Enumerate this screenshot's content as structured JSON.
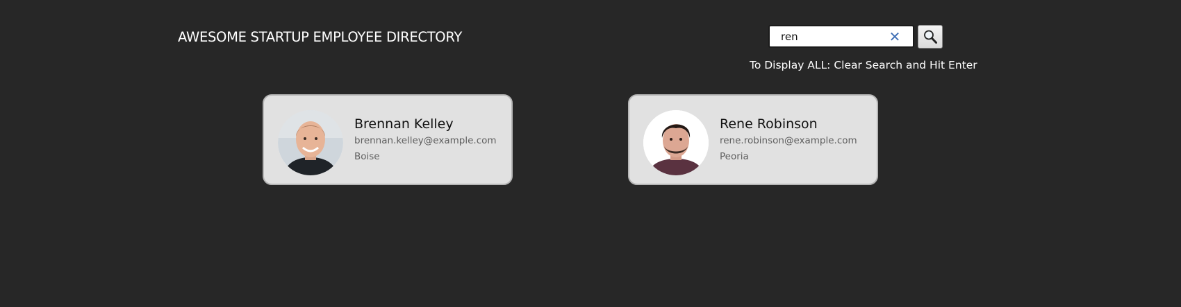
{
  "header": {
    "title": "AWESOME STARTUP EMPLOYEE DIRECTORY"
  },
  "search": {
    "value": "ren",
    "clear_icon": "close-icon",
    "button_icon": "search-icon",
    "hint": "To Display ALL: Clear Search and Hit Enter"
  },
  "employees": [
    {
      "name": "Brennan Kelley",
      "email": "brennan.kelley@example.com",
      "city": "Boise",
      "avatar_icon": "avatar-photo"
    },
    {
      "name": "Rene Robinson",
      "email": "rene.robinson@example.com",
      "city": "Peoria",
      "avatar_icon": "avatar-photo"
    }
  ],
  "colors": {
    "background": "#272727",
    "card": "#e1e1e1",
    "clear_icon": "#3f6fb5"
  }
}
